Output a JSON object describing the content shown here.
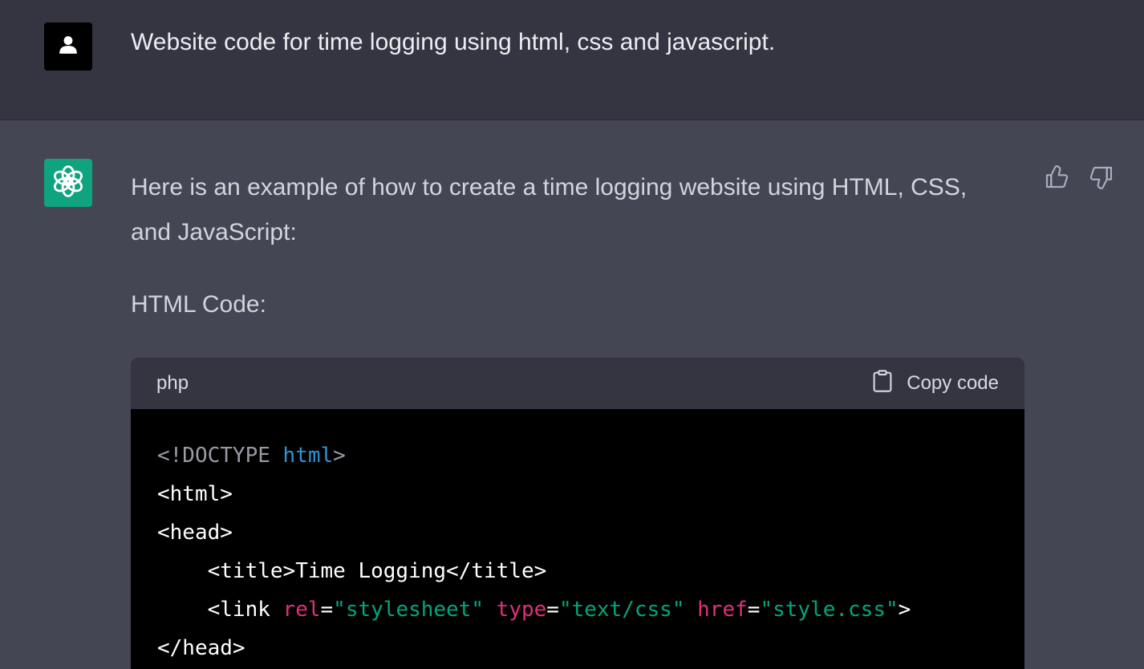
{
  "user_message": {
    "text": "Website code for time logging using html, css and javascript."
  },
  "assistant_message": {
    "intro": "Here is an example of how to create a time logging website using HTML, CSS, and JavaScript:",
    "heading": "HTML Code:"
  },
  "code_block": {
    "language": "php",
    "copy_label": "Copy code",
    "lines": [
      {
        "indent": "",
        "tokens": [
          {
            "text": "<!DOCTYPE ",
            "color": "gray"
          },
          {
            "text": "html",
            "color": "blue"
          },
          {
            "text": ">",
            "color": "gray"
          }
        ]
      },
      {
        "indent": "",
        "tokens": [
          {
            "text": "<html>",
            "color": "white"
          }
        ]
      },
      {
        "indent": "",
        "tokens": [
          {
            "text": "<head>",
            "color": "white"
          }
        ]
      },
      {
        "indent": "    ",
        "tokens": [
          {
            "text": "<title>Time Logging</title>",
            "color": "white"
          }
        ]
      },
      {
        "indent": "    ",
        "tokens": [
          {
            "text": "<link ",
            "color": "white"
          },
          {
            "text": "rel",
            "color": "pink"
          },
          {
            "text": "=",
            "color": "white"
          },
          {
            "text": "\"stylesheet\"",
            "color": "green"
          },
          {
            "text": " ",
            "color": "white"
          },
          {
            "text": "type",
            "color": "pink"
          },
          {
            "text": "=",
            "color": "white"
          },
          {
            "text": "\"text/css\"",
            "color": "green"
          },
          {
            "text": " ",
            "color": "white"
          },
          {
            "text": "href",
            "color": "pink"
          },
          {
            "text": "=",
            "color": "white"
          },
          {
            "text": "\"style.css\"",
            "color": "green"
          },
          {
            "text": ">",
            "color": "white"
          }
        ]
      },
      {
        "indent": "",
        "tokens": [
          {
            "text": "</head>",
            "color": "white"
          }
        ]
      }
    ]
  },
  "colors": {
    "user_bg": "#343541",
    "assistant_bg": "#444654",
    "ai_avatar": "#10a37f",
    "code_bg": "#000000",
    "code_header_bg": "#343541"
  },
  "icons": {
    "user_avatar": "user-icon",
    "ai_avatar": "openai-logo-icon",
    "copy": "clipboard-icon",
    "like": "thumbs-up-icon",
    "dislike": "thumbs-down-icon"
  }
}
